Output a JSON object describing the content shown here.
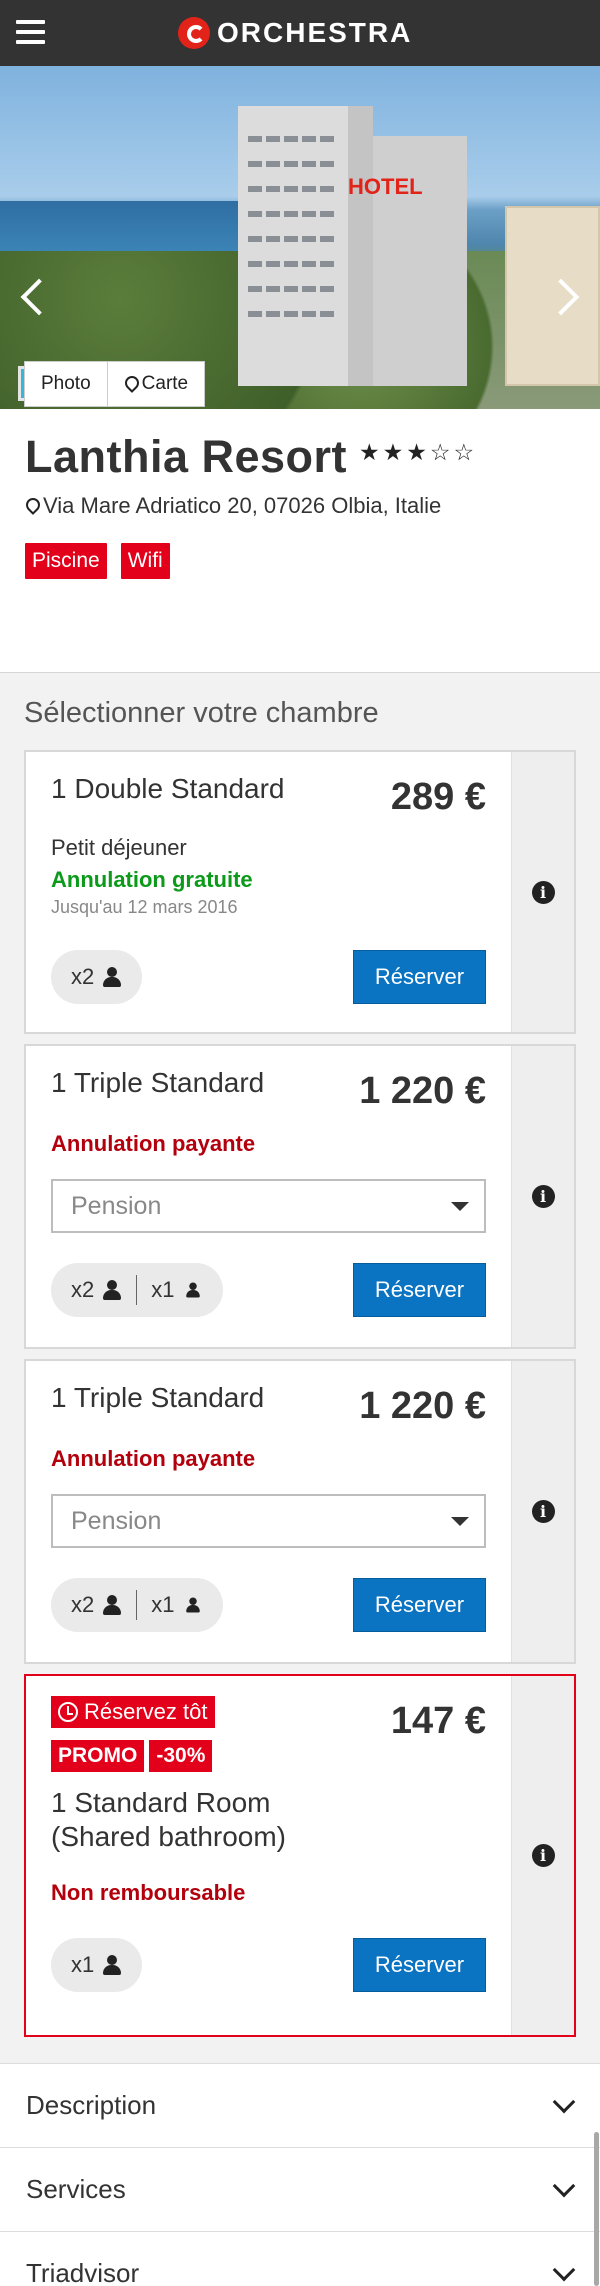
{
  "header": {
    "logo_text": "ORCHESTRA",
    "menu_icon": "hamburger-icon"
  },
  "gallery": {
    "tabs": [
      {
        "label": "Photo"
      },
      {
        "label": "Carte"
      }
    ],
    "hotel_sign": "HOTEL"
  },
  "hotel": {
    "name": "Lanthia Resort",
    "stars": 3,
    "max_stars": 5,
    "address": "Via Mare Adriatico 20, 07026 Olbia, Italie",
    "tags": [
      "Piscine",
      "Wifi"
    ]
  },
  "rooms_section": {
    "title": "Sélectionner votre chambre",
    "reserve_label": "Réserver",
    "rooms": [
      {
        "name": "1 Double Standard",
        "price": "289 €",
        "meal": "Petit déjeuner",
        "cancellation": "Annulation gratuite",
        "cancellation_until": "Jusqu'au 12 mars 2016",
        "adults": "x2"
      },
      {
        "name": "1 Triple Standard",
        "price": "1 220 €",
        "cancellation": "Annulation payante",
        "board_placeholder": "Pension",
        "adults": "x2",
        "children": "x1"
      },
      {
        "name": "1 Triple Standard",
        "price": "1 220 €",
        "cancellation": "Annulation payante",
        "board_placeholder": "Pension",
        "adults": "x2",
        "children": "x1"
      },
      {
        "early_badge": "Réservez tôt",
        "promo_badge": "PROMO",
        "discount_badge": "-30%",
        "name_line1": "1 Standard Room",
        "name_line2": "(Shared bathroom)",
        "price": "147 €",
        "cancellation": "Non remboursable",
        "adults": "x1"
      }
    ]
  },
  "accordion": [
    {
      "label": "Description"
    },
    {
      "label": "Services"
    },
    {
      "label": "Triadvisor"
    }
  ],
  "colors": {
    "brand_red": "#e2001a",
    "button_blue": "#0a73c2",
    "free_green": "#0b9a1a",
    "pay_red": "#b3000d",
    "header_bg": "#333333"
  }
}
